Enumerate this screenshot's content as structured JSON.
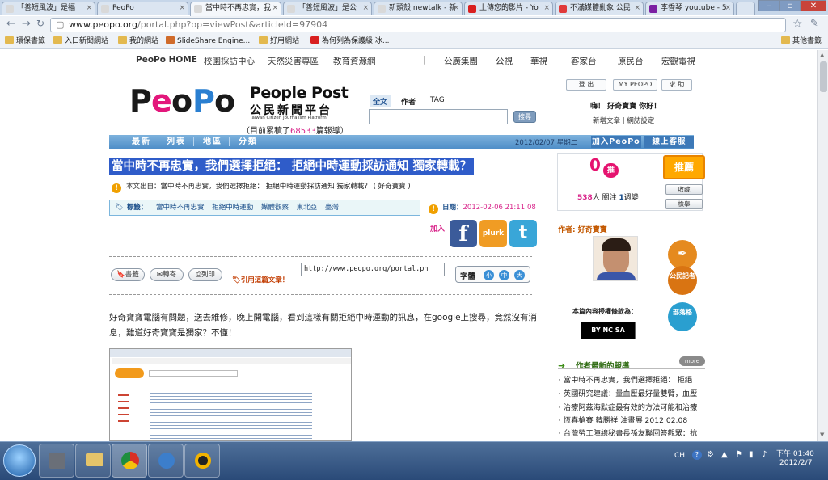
{
  "browser": {
    "tabs": [
      {
        "label": "「善短風波」是福"
      },
      {
        "label": "PeoPo"
      },
      {
        "label": "當中時不再忠實，我"
      },
      {
        "label": "「善短風波」是公"
      },
      {
        "label": "新頭殼 newtalk - 新"
      },
      {
        "label": "上傳您的影片 - Yo"
      },
      {
        "label": "不滿媒體亂象 公民"
      },
      {
        "label": "李香琴 youtube - 5"
      }
    ],
    "url_site": "www.peopo.org",
    "url_path": "/portal.php?op=viewPost&articleId=97904",
    "bookmarks": [
      "環保書籤",
      "入口新聞網站",
      "我的網站",
      "SlideShare Engine...",
      "好用網站",
      "為何列為保護級 冰..."
    ],
    "other_bookmarks": "其他書籤"
  },
  "site": {
    "topnav": [
      "PeoPo HOME",
      "校園採訪中心",
      "天然災害專區",
      "教育資源網",
      "公廣集團",
      "公視",
      "華視",
      "客家台",
      "原民台",
      "宏觀電視"
    ],
    "brand_en": "People Post",
    "brand_zh": "公民新聞平台",
    "brand_sub": "Taiwan Citizen Journalism Platform",
    "stat_prefix": "（目前累積了",
    "stat_count": "68533",
    "stat_suffix": "篇報導）",
    "search_tabs": [
      "全文",
      "作者",
      "TAG"
    ],
    "search_button": "搜尋",
    "account_buttons": [
      "登 出",
      "MY PEOPO",
      "求 助"
    ],
    "greeting": "嗨！ 好奇寶寶 你好！",
    "user_links": "新增文章 | 網誌設定",
    "bluebar": [
      "最新",
      "列表",
      "地區",
      "分類"
    ],
    "date_today": "2012/02/07 星期二",
    "join": "加入PeoPo",
    "help": "線上客服"
  },
  "article": {
    "title": "當中時不再忠實，我們選擇拒絕： 拒絕中時運動採訪通知 獨家轉載？",
    "source": "本文出自：當中時不再忠實，我們選擇拒絕： 拒絕中時運動採訪通知 獨家轉載？ ( 好奇寶寶 )",
    "tag_label": "標籤：",
    "tags": [
      "當中時不再忠實",
      "拒絕中時運動",
      "媒體觀察",
      "東北亞",
      "臺灣"
    ],
    "date_label": "日期：",
    "date_value": "2012-02-06 21:11:08",
    "add_label": "加入",
    "social": [
      "f",
      "plurk",
      "t"
    ],
    "tools": [
      "書籤",
      "轉寄",
      "列印"
    ],
    "quote": "引用這篇文章！",
    "quote_url": "http://www.peopo.org/portal.ph",
    "font_label": "字體",
    "font_sizes": [
      "小",
      "中",
      "大"
    ],
    "body": "好奇寶寶電腦有問題，送去維修，晚上開電腦，看到這樣有關拒絕中時運動的訊息，在google上搜尋，竟然沒有消息，難道好奇寶寶是獨家？不懂！"
  },
  "sidebar": {
    "push_count": "0",
    "push_label": "推",
    "follow_count": "538",
    "follow_text": "人 關注 ",
    "group_count": "1",
    "group_text": "週變",
    "recommend": "推薦",
    "collect": "收藏",
    "report": "檢舉",
    "author_label": "作者: 好奇寶寶",
    "licence": "本篇內容授權條款為：",
    "cc": "BY NC SA",
    "badges": [
      "公民記者",
      "部落格"
    ],
    "news_title": "作者最新的報導",
    "more": "more",
    "news": [
      "當中時不再忠實，我們選擇拒絕： 拒絕",
      "英國研究建議：量血壓最好量雙臂，血壓",
      "治療阿茲海默症最有效的方法可能和治療",
      "恆春槍賽 韓勝祥 油畫展 2012.02.08",
      "台灣勞工陣線秘書長孫友聯回答觀眾：抗"
    ]
  },
  "taskbar": {
    "lang": "CH",
    "time": "下午 01:40",
    "date": "2012/2/7"
  }
}
